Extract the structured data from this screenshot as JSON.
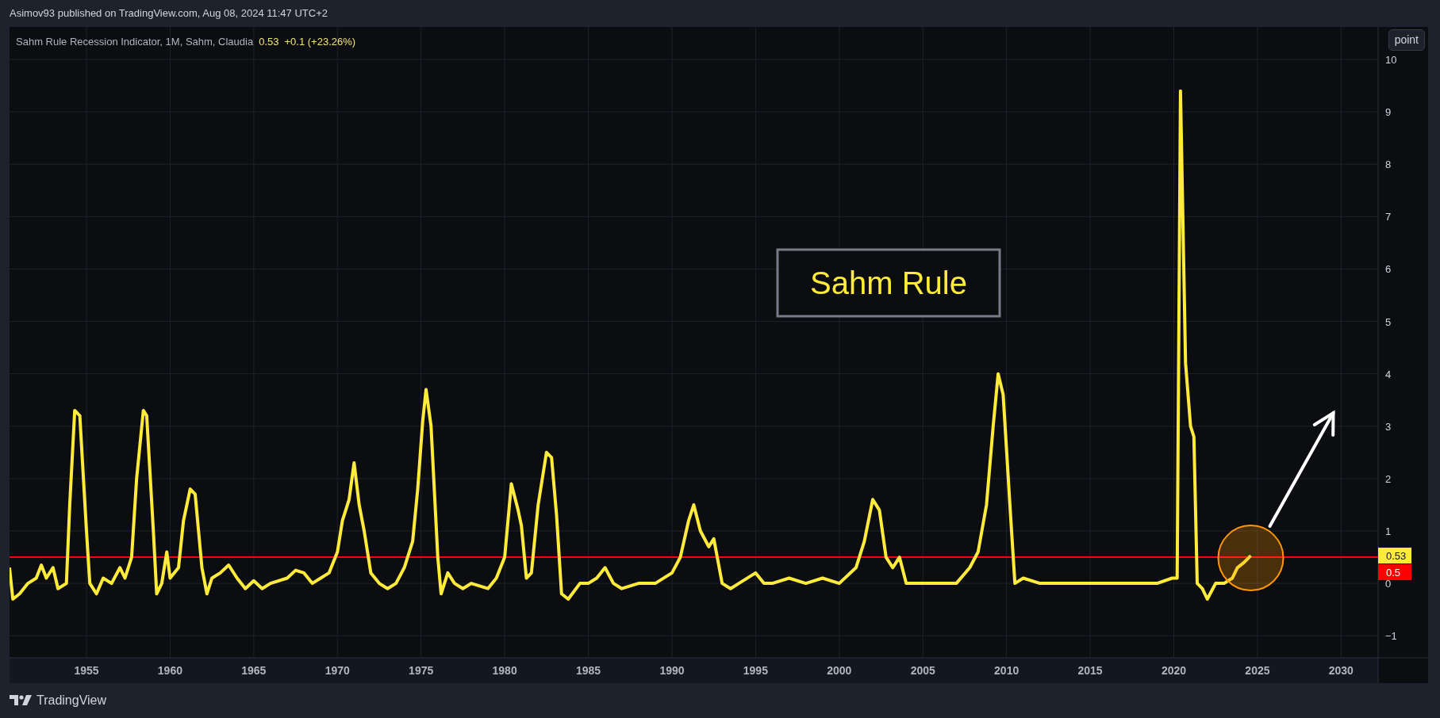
{
  "header": {
    "text": "Asimov93 published on TradingView.com, Aug 08, 2024 11:47 UTC+2"
  },
  "legend": {
    "title": "Sahm Rule Recession Indicator, 1M, Sahm, Claudia",
    "value": "0.53",
    "change": "+0.1 (+23.26%)"
  },
  "scale_button": {
    "label": "point"
  },
  "axis_labels": {
    "last_value": "0.53"
  },
  "chart_data": {
    "type": "line",
    "grid": true,
    "x": [
      1950.4,
      1950.6,
      1951,
      1951.5,
      1952,
      1952.3,
      1952.6,
      1953,
      1953.3,
      1953.8,
      1954.0,
      1954.3,
      1954.6,
      1955.0,
      1955.2,
      1955.6,
      1956,
      1956.5,
      1957,
      1957.3,
      1957.7,
      1958.0,
      1958.4,
      1958.6,
      1959.0,
      1959.2,
      1959.5,
      1959.8,
      1960.0,
      1960.5,
      1960.8,
      1961.2,
      1961.5,
      1961.9,
      1962.2,
      1962.5,
      1963,
      1963.5,
      1964,
      1964.5,
      1965,
      1965.5,
      1966,
      1967,
      1967.5,
      1968,
      1968.5,
      1969,
      1969.5,
      1970,
      1970.3,
      1970.7,
      1971.0,
      1971.3,
      1971.6,
      1972.0,
      1972.5,
      1973,
      1973.5,
      1974,
      1974.5,
      1974.8,
      1975.1,
      1975.3,
      1975.6,
      1976.0,
      1976.2,
      1976.6,
      1977,
      1977.5,
      1978,
      1979,
      1979.5,
      1980.0,
      1980.4,
      1980.8,
      1981.0,
      1981.3,
      1981.6,
      1982.0,
      1982.5,
      1982.8,
      1983.1,
      1983.4,
      1983.8,
      1984.5,
      1985,
      1985.5,
      1986,
      1986.5,
      1987,
      1988,
      1989,
      1990,
      1990.5,
      1991,
      1991.3,
      1991.7,
      1992.2,
      1992.5,
      1993.0,
      1993.5,
      1994,
      1995,
      1995.5,
      1996,
      1997,
      1998,
      1999,
      2000,
      2001,
      2001.5,
      2002.0,
      2002.4,
      2002.8,
      2003.2,
      2003.6,
      2004.0,
      2005,
      2006,
      2007,
      2007.8,
      2008.3,
      2008.8,
      2009.2,
      2009.5,
      2009.8,
      2010.2,
      2010.5,
      2011,
      2012,
      2013,
      2014,
      2015,
      2016,
      2017,
      2018,
      2019,
      2019.9,
      2020.2,
      2020.4,
      2020.7,
      2021.0,
      2021.2,
      2021.4,
      2021.7,
      2022.0,
      2022.5,
      2023,
      2023.5,
      2023.8,
      2024.2,
      2024.6
    ],
    "series": [
      {
        "color": "#ffeb3b",
        "values": [
          0.3,
          -0.3,
          -0.2,
          0.0,
          0.1,
          0.35,
          0.1,
          0.3,
          -0.1,
          0.0,
          1.5,
          3.3,
          3.2,
          1.0,
          0.0,
          -0.2,
          0.1,
          0.0,
          0.3,
          0.1,
          0.5,
          2.0,
          3.3,
          3.2,
          1.0,
          -0.2,
          0.0,
          0.6,
          0.1,
          0.3,
          1.2,
          1.8,
          1.7,
          0.3,
          -0.2,
          0.1,
          0.2,
          0.35,
          0.1,
          -0.1,
          0.05,
          -0.1,
          0.0,
          0.1,
          0.25,
          0.2,
          0.0,
          0.1,
          0.2,
          0.6,
          1.2,
          1.6,
          2.3,
          1.5,
          1.0,
          0.2,
          0.0,
          -0.1,
          0.0,
          0.3,
          0.8,
          1.8,
          3.1,
          3.7,
          3.0,
          0.5,
          -0.2,
          0.2,
          0.0,
          -0.1,
          0.0,
          -0.1,
          0.1,
          0.5,
          1.9,
          1.4,
          1.1,
          0.1,
          0.2,
          1.5,
          2.5,
          2.4,
          1.3,
          -0.2,
          -0.3,
          0.0,
          0.0,
          0.1,
          0.3,
          0.0,
          -0.1,
          0.0,
          0.0,
          0.2,
          0.5,
          1.2,
          1.5,
          1.0,
          0.7,
          0.85,
          0.0,
          -0.1,
          0.0,
          0.2,
          0.0,
          0.0,
          0.1,
          0.0,
          0.1,
          0.0,
          0.3,
          0.8,
          1.6,
          1.4,
          0.5,
          0.3,
          0.5,
          0.0,
          0.0,
          0.0,
          0.0,
          0.3,
          0.6,
          1.5,
          3.0,
          4.0,
          3.6,
          1.5,
          0.0,
          0.1,
          0.0,
          0.0,
          0.0,
          0.0,
          0.0,
          0.0,
          0.0,
          0.0,
          0.1,
          0.1,
          9.4,
          4.2,
          3.0,
          2.8,
          0.0,
          -0.1,
          -0.3,
          0.0,
          0.0,
          0.1,
          0.3,
          0.4,
          0.53
        ]
      }
    ],
    "xlim": [
      1950.4,
      2035.2
    ],
    "ylim": [
      -1.42,
      10.62
    ],
    "xticks": [
      1955,
      1960,
      1965,
      1970,
      1975,
      1980,
      1985,
      1990,
      1995,
      2000,
      2005,
      2010,
      2015,
      2020,
      2025,
      2030
    ],
    "yticks": [
      -1,
      0,
      1,
      2,
      3,
      4,
      5,
      6,
      7,
      8,
      9,
      10
    ],
    "ref_lines": [
      {
        "axis": "y",
        "value": 0.5,
        "color": "#ff0000",
        "label": "0.5"
      }
    ],
    "annotations": [
      "Sahm Rule"
    ]
  },
  "footer": {
    "brand": "TradingView"
  }
}
